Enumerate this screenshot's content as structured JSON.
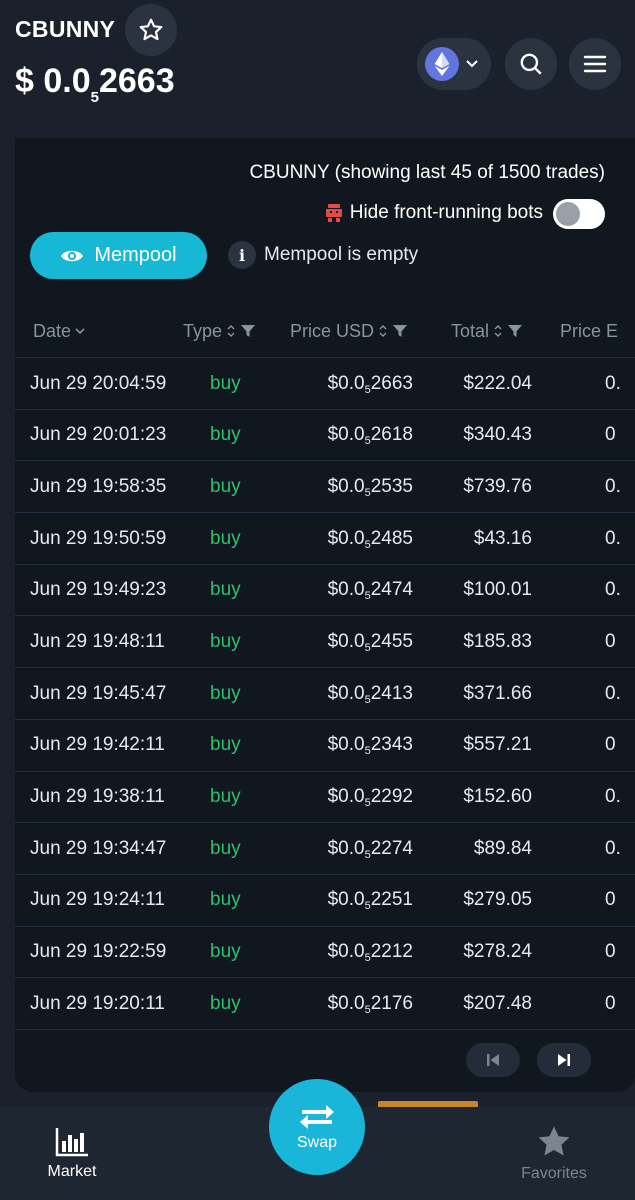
{
  "header": {
    "token_name": "CBUNNY",
    "price_prefix": "$ 0.0",
    "price_sub": "5",
    "price_rest": "2663"
  },
  "trades": {
    "showing_text": "CBUNNY (showing last 45 of 1500 trades)",
    "hide_bots_label": "Hide front-running bots",
    "mempool_label": "Mempool",
    "mempool_status": "Mempool is empty",
    "columns": [
      "Date",
      "Type",
      "Price USD",
      "Total",
      "Price E"
    ],
    "rows": [
      {
        "date": "Jun 29 20:04:59",
        "type": "buy",
        "p_pre": "$0.0",
        "p_sub": "5",
        "p_rest": "2663",
        "total": "$222.04",
        "extra": "0."
      },
      {
        "date": "Jun 29 20:01:23",
        "type": "buy",
        "p_pre": "$0.0",
        "p_sub": "5",
        "p_rest": "2618",
        "total": "$340.43",
        "extra": "0"
      },
      {
        "date": "Jun 29 19:58:35",
        "type": "buy",
        "p_pre": "$0.0",
        "p_sub": "5",
        "p_rest": "2535",
        "total": "$739.76",
        "extra": "0."
      },
      {
        "date": "Jun 29 19:50:59",
        "type": "buy",
        "p_pre": "$0.0",
        "p_sub": "5",
        "p_rest": "2485",
        "total": "$43.16",
        "extra": "0."
      },
      {
        "date": "Jun 29 19:49:23",
        "type": "buy",
        "p_pre": "$0.0",
        "p_sub": "5",
        "p_rest": "2474",
        "total": "$100.01",
        "extra": "0."
      },
      {
        "date": "Jun 29 19:48:11",
        "type": "buy",
        "p_pre": "$0.0",
        "p_sub": "5",
        "p_rest": "2455",
        "total": "$185.83",
        "extra": "0"
      },
      {
        "date": "Jun 29 19:45:47",
        "type": "buy",
        "p_pre": "$0.0",
        "p_sub": "5",
        "p_rest": "2413",
        "total": "$371.66",
        "extra": "0."
      },
      {
        "date": "Jun 29 19:42:11",
        "type": "buy",
        "p_pre": "$0.0",
        "p_sub": "5",
        "p_rest": "2343",
        "total": "$557.21",
        "extra": "0"
      },
      {
        "date": "Jun 29 19:38:11",
        "type": "buy",
        "p_pre": "$0.0",
        "p_sub": "5",
        "p_rest": "2292",
        "total": "$152.60",
        "extra": "0."
      },
      {
        "date": "Jun 29 19:34:47",
        "type": "buy",
        "p_pre": "$0.0",
        "p_sub": "5",
        "p_rest": "2274",
        "total": "$89.84",
        "extra": "0."
      },
      {
        "date": "Jun 29 19:24:11",
        "type": "buy",
        "p_pre": "$0.0",
        "p_sub": "5",
        "p_rest": "2251",
        "total": "$279.05",
        "extra": "0"
      },
      {
        "date": "Jun 29 19:22:59",
        "type": "buy",
        "p_pre": "$0.0",
        "p_sub": "5",
        "p_rest": "2212",
        "total": "$278.24",
        "extra": "0"
      },
      {
        "date": "Jun 29 19:20:11",
        "type": "buy",
        "p_pre": "$0.0",
        "p_sub": "5",
        "p_rest": "2176",
        "total": "$207.48",
        "extra": "0"
      }
    ]
  },
  "nav": {
    "market_label": "Market",
    "swap_label": "Swap",
    "favorites_label": "Favorites"
  },
  "colors": {
    "accent": "#17b7d6",
    "buy": "#2fbf71",
    "background": "#1a212c",
    "card": "#11171f"
  }
}
